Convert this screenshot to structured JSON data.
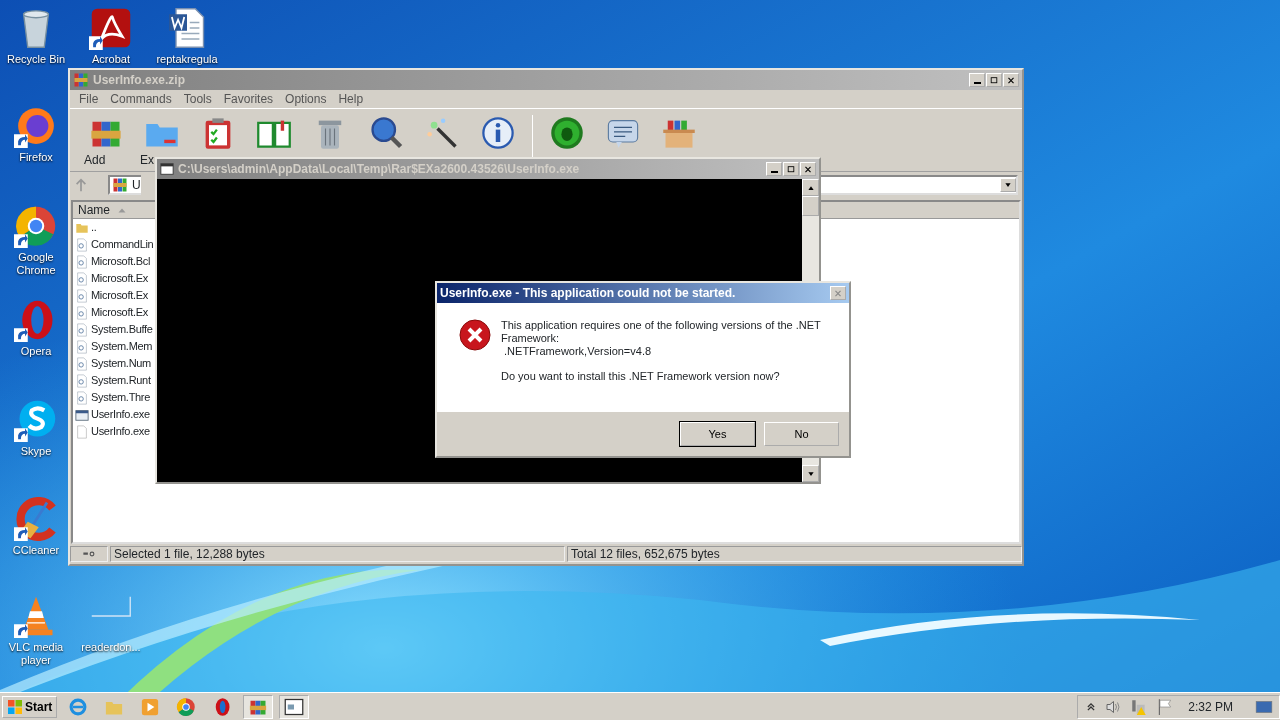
{
  "desktop_icons": [
    {
      "label": "Recycle Bin",
      "kind": "recycle"
    },
    {
      "label": "Acrobat",
      "kind": "acrobat"
    },
    {
      "label": "reptakregula",
      "kind": "word"
    },
    {
      "label": "Firefox",
      "kind": "firefox"
    },
    {
      "label": "Google Chrome",
      "kind": "chrome"
    },
    {
      "label": "Opera",
      "kind": "opera"
    },
    {
      "label": "Skype",
      "kind": "skype"
    },
    {
      "label": "CCleaner",
      "kind": "ccleaner"
    },
    {
      "label": "VLC media player",
      "kind": "vlc"
    },
    {
      "label": "readerdon...",
      "kind": "blank"
    }
  ],
  "winrar": {
    "title": "UserInfo.exe.zip",
    "active": false,
    "menu": [
      "File",
      "Commands",
      "Tools",
      "Favorites",
      "Options",
      "Help"
    ],
    "toolbar": [
      {
        "kind": "add",
        "label": "Add"
      },
      {
        "kind": "extract",
        "label": "Ex"
      },
      {
        "kind": "test"
      },
      {
        "kind": "view"
      },
      {
        "kind": "delete"
      },
      {
        "kind": "find"
      },
      {
        "kind": "wizard"
      },
      {
        "kind": "info"
      },
      {
        "kind": "separator"
      },
      {
        "kind": "virus"
      },
      {
        "kind": "comment"
      },
      {
        "kind": "sfx"
      }
    ],
    "address": "U",
    "column": "Name",
    "files": [
      {
        "name": "..",
        "kind": "folder"
      },
      {
        "name": "CommandLin",
        "kind": "dll"
      },
      {
        "name": "Microsoft.Bcl",
        "kind": "dll"
      },
      {
        "name": "Microsoft.Ex",
        "kind": "dll"
      },
      {
        "name": "Microsoft.Ex",
        "kind": "dll"
      },
      {
        "name": "Microsoft.Ex",
        "kind": "dll"
      },
      {
        "name": "System.Buffe",
        "kind": "dll"
      },
      {
        "name": "System.Mem",
        "kind": "dll"
      },
      {
        "name": "System.Num",
        "kind": "dll"
      },
      {
        "name": "System.Runt",
        "kind": "dll"
      },
      {
        "name": "System.Thre",
        "kind": "dll"
      },
      {
        "name": "UserInfo.exe",
        "kind": "exe"
      },
      {
        "name": "UserInfo.exe",
        "kind": "file"
      }
    ],
    "status_left": "Selected 1 file, 12,288 bytes",
    "status_right": "Total 12 files, 652,675 bytes"
  },
  "console": {
    "title": "C:\\Users\\admin\\AppData\\Local\\Temp\\Rar$EXa2600.43526\\UserInfo.exe",
    "active": false
  },
  "dialog": {
    "title": "UserInfo.exe - This application could not be started.",
    "active": true,
    "message": [
      "This application requires one of the following versions of the .NET Framework:",
      " .NETFramework,Version=v4.8"
    ],
    "question": "Do you want to install this .NET Framework version now?",
    "buttons": [
      {
        "label": "Yes",
        "default": true
      },
      {
        "label": "No",
        "default": false
      }
    ]
  },
  "taskbar": {
    "start": "Start",
    "apps": [
      {
        "kind": "ie",
        "active": false
      },
      {
        "kind": "explorer",
        "active": false
      },
      {
        "kind": "media",
        "active": false
      },
      {
        "kind": "chrome",
        "active": false
      },
      {
        "kind": "opera",
        "active": false
      },
      {
        "kind": "winrar",
        "active": true
      },
      {
        "kind": "console",
        "active": true
      }
    ],
    "time": "2:32 PM"
  }
}
